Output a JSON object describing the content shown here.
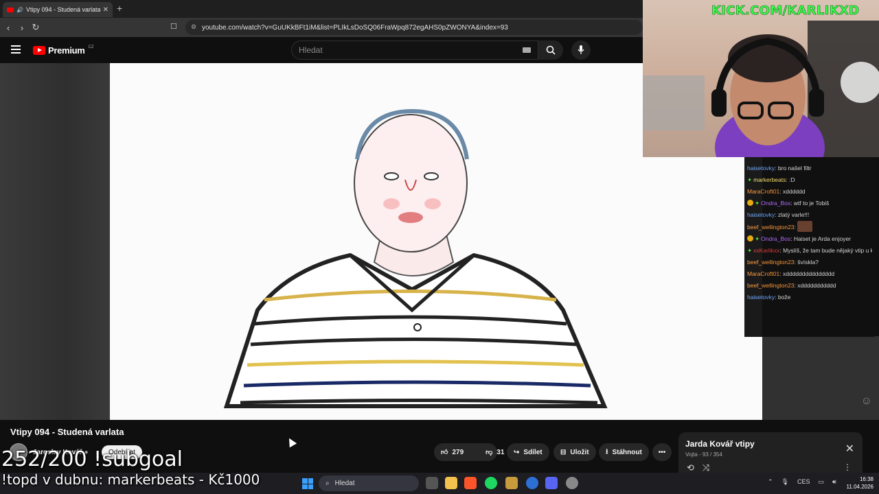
{
  "browser": {
    "tab_title": "Vtipy 094 - Studená varlata -",
    "new_tab_icon": "plus-icon",
    "url": "youtube.com/watch?v=GuUKkBFt1iM&list=PLIkLsDoSQ06FraWpq872egAHS0pZWONYA&index=93"
  },
  "youtube": {
    "logo_text": "Premium",
    "logo_region": "CZ",
    "search_placeholder": "Hledat",
    "video_title": "Vtipy 094 - Studená varlata",
    "channel_name": "Jaroslav Kovář",
    "subscribe_label": "Odebírat",
    "likes": "279",
    "dislikes": "31",
    "share_label": "Sdílet",
    "save_label": "Uložit",
    "download_label": "Stáhnout",
    "more_label": "•••"
  },
  "playlist": {
    "title": "Jarda Kovář vtipy",
    "subtitle": "Vojta - 93 / 354"
  },
  "overlay": {
    "kick_link": "KICK.COM/KARLIKXD",
    "subgoal": "252/200 !subgoal",
    "topd": "!topd v dubnu: markerbeats - Kč1000"
  },
  "chat": {
    "messages": [
      {
        "user": "haisetovky",
        "color": "#6fa8ff",
        "text": "bro našel filtr",
        "badge": false,
        "gem": false
      },
      {
        "user": "markerbeats",
        "color": "#f7e26b",
        "text": ":D",
        "badge": false,
        "gem": true
      },
      {
        "user": "MaraCroft01",
        "color": "#ff9a3c",
        "text": "xdddddd",
        "badge": false,
        "gem": false
      },
      {
        "user": "Ondra_Bos",
        "color": "#b66dff",
        "text": "wtf to je Tobiš",
        "badge": true,
        "gem": true
      },
      {
        "user": "haisetovky",
        "color": "#6fa8ff",
        "text": "zlatý varle!!!",
        "badge": false,
        "gem": false
      },
      {
        "user": "beef_wellington23",
        "color": "#ff9a3c",
        "text": "",
        "badge": false,
        "gem": false,
        "emote": true
      },
      {
        "user": "Ondra_Bos",
        "color": "#b66dff",
        "text": "Haiset je Arda enjoyer",
        "badge": true,
        "gem": true
      },
      {
        "user": "xxKarlikxx",
        "color": "#e23b3b",
        "text": "Myslíš, že tam bude nějaký vtip u kterého se budeš smát hodně?",
        "badge": false,
        "gem": true
      },
      {
        "user": "beef_wellington23",
        "color": "#ff9a3c",
        "text": "švískla?",
        "badge": false,
        "gem": false
      },
      {
        "user": "MaraCroft01",
        "color": "#ff9a3c",
        "text": "xddddddddddddddd",
        "badge": false,
        "gem": false
      },
      {
        "user": "beef_wellington23",
        "color": "#ff9a3c",
        "text": "xddddddddddd",
        "badge": false,
        "gem": false
      },
      {
        "user": "haisetovky",
        "color": "#6fa8ff",
        "text": "bože",
        "badge": false,
        "gem": false
      }
    ]
  },
  "taskbar": {
    "search_label": "Hledat",
    "language": "CES",
    "time": "16:38",
    "date": "11.04.2026"
  }
}
